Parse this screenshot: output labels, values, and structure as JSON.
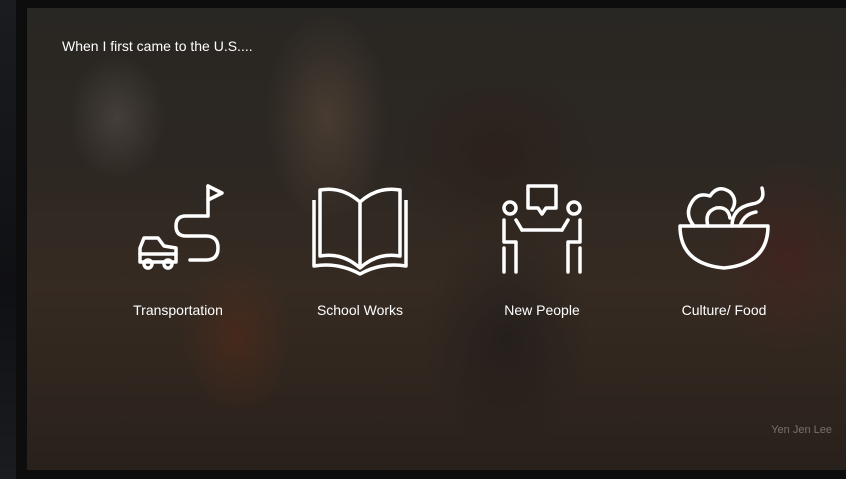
{
  "slide": {
    "heading": "When I first came to the U.S....",
    "credit": "Yen Jen Lee"
  },
  "items": [
    {
      "label": "Transportation",
      "icon": "car-route-flag-icon"
    },
    {
      "label": "School Works",
      "icon": "open-book-icon"
    },
    {
      "label": "New People",
      "icon": "people-conversation-icon"
    },
    {
      "label": "Culture/ Food",
      "icon": "food-bowl-icon"
    }
  ],
  "colors": {
    "text": "#ffffff",
    "icon_stroke": "#ffffff"
  }
}
